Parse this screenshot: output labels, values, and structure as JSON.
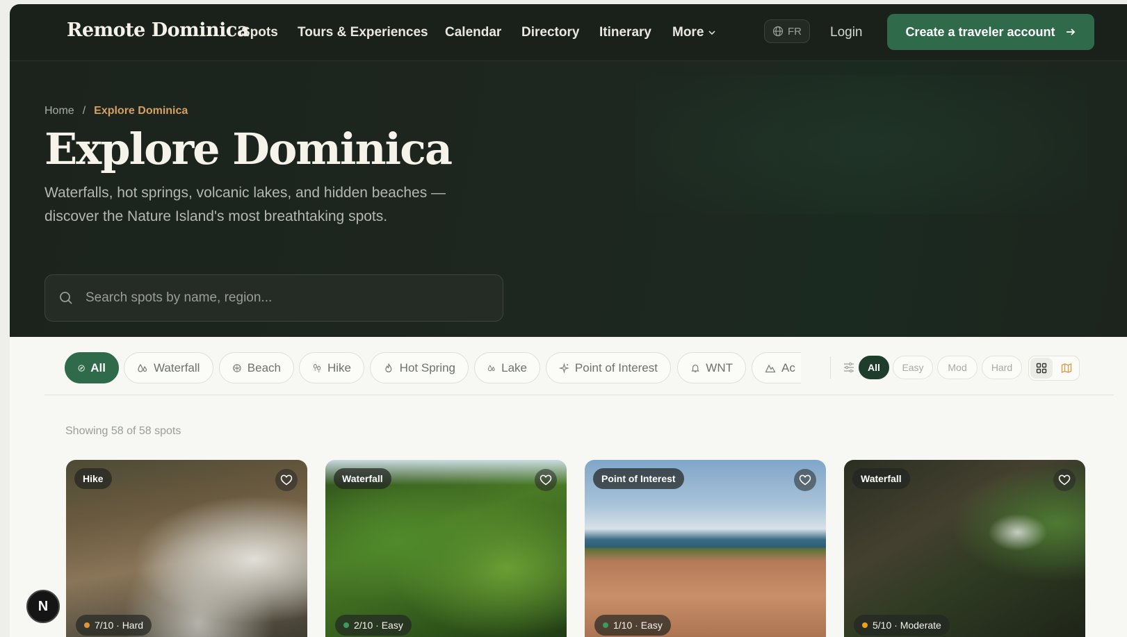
{
  "nav": {
    "brand": "Remote Dominica",
    "items": [
      "Spots",
      "Tours & Experiences",
      "Calendar",
      "Directory",
      "Itinerary",
      "More"
    ],
    "lang": "FR",
    "login": "Login",
    "cta": "Create a traveler account"
  },
  "hero": {
    "breadcrumb_home": "Home",
    "breadcrumb_sep": "/",
    "breadcrumb_current": "Explore Dominica",
    "title": "Explore Dominica",
    "subtitle": "Waterfalls, hot springs, volcanic lakes, and hidden beaches — discover the Nature Island's most breathtaking spots.",
    "search_placeholder": "Search spots by name, region..."
  },
  "filters": {
    "categories": [
      "All",
      "Waterfall",
      "Beach",
      "Hike",
      "Hot Spring",
      "Lake",
      "Point of Interest",
      "WNT",
      "Ac"
    ],
    "active_category": "All",
    "difficulty": [
      "All",
      "Easy",
      "Mod",
      "Hard"
    ],
    "active_difficulty": "All"
  },
  "results": {
    "count_text": "Showing 58 of 58 spots"
  },
  "cards": [
    {
      "tag": "Hike",
      "rating": "7/10 · Hard",
      "dot_color": "#e0943a"
    },
    {
      "tag": "Waterfall",
      "rating": "2/10 · Easy",
      "dot_color": "#3f9a5a"
    },
    {
      "tag": "Point of Interest",
      "rating": "1/10 · Easy",
      "dot_color": "#3f9a5a"
    },
    {
      "tag": "Waterfall",
      "rating": "5/10 · Moderate",
      "dot_color": "#e8a21c"
    }
  ],
  "floating_badge": "N",
  "colors": {
    "accent": "#2f6b4a",
    "breadcrumb_active": "#d5a062",
    "hero_bg": "#1c231d"
  }
}
